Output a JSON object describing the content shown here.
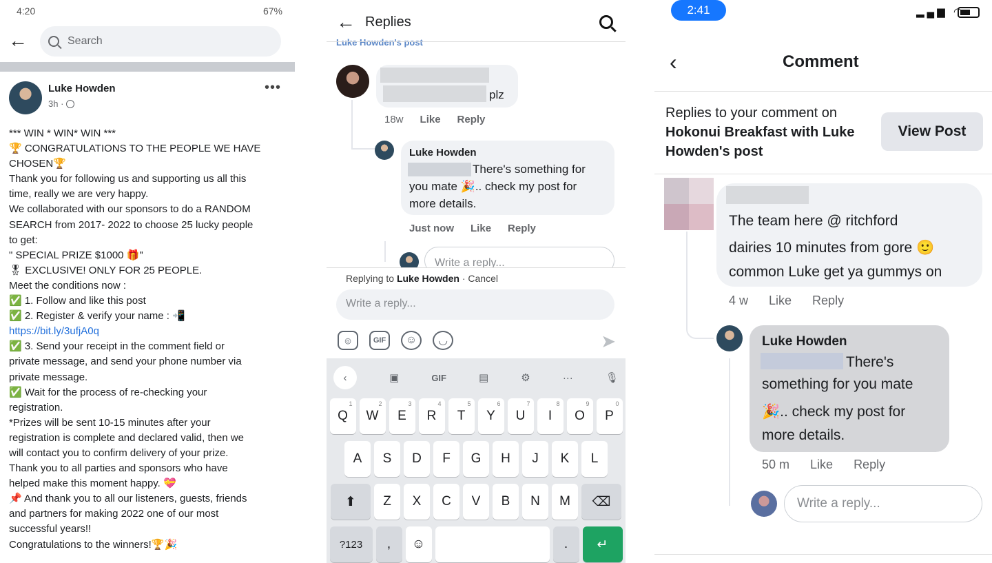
{
  "panel1": {
    "status_time": "4:20",
    "status_battery": "67%",
    "back_icon": "←",
    "search_placeholder": "Search",
    "author": "Luke Howden",
    "post_time": "3h ·",
    "more": "•••",
    "lines": [
      "*** WIN * WIN* WIN ***",
      "🏆 CONGRATULATIONS TO THE PEOPLE WE HAVE",
      "CHOSEN🏆",
      "Thank you for following us and supporting us all this",
      "time, really we are very happy.",
      "We collaborated with our sponsors to do a RANDOM",
      "SEARCH from 2017- 2022 to choose 25 lucky people",
      "to get:",
      "\" SPECIAL PRIZE $1000 🎁\"",
      "🎖 EXCLUSIVE! ONLY FOR 25 PEOPLE.",
      "Meet the conditions now :",
      "✅ 1. Follow and like this post",
      "✅ 2. Register & verify your name : 📲",
      "https://bit.ly/3ufjA0q",
      "✅ 3. Send your receipt in the comment field or",
      "private message, and send your phone number via",
      "private message.",
      "✅ Wait for the process of re-checking your",
      "registration.",
      "*Prizes will be sent 10-15 minutes after your",
      "registration is complete and declared valid, then we",
      "will contact you to confirm delivery of your prize.",
      "Thank you to all parties and sponsors who have",
      "helped make this moment happy. 💝",
      "📌 And thank you to all our listeners, guests, friends",
      "and partners for making 2022 one of our most",
      "successful years!!",
      "Congratulations to the winners!🏆🎉"
    ]
  },
  "panel2": {
    "title": "Replies",
    "cut_link": "Luke Howden's post",
    "c1_text": "plz",
    "c1_time": "18w",
    "like": "Like",
    "reply": "Reply",
    "c2_author": "Luke Howden",
    "c2_line1": "There's something for",
    "c2_line2": "you mate 🎉.. check my post for",
    "c2_line3": "more details.",
    "c2_time": "Just now",
    "write_reply_small": "Write a reply...",
    "replying_to_prefix": "Replying to",
    "replying_to_name": "Luke Howden",
    "cancel": "· Cancel",
    "input_placeholder": "Write a reply...",
    "gif": "GIF",
    "kb_gif": "GIF",
    "kb_more": "···",
    "row1": [
      [
        "Q",
        "1"
      ],
      [
        "W",
        "2"
      ],
      [
        "E",
        "3"
      ],
      [
        "R",
        "4"
      ],
      [
        "T",
        "5"
      ],
      [
        "Y",
        "6"
      ],
      [
        "U",
        "7"
      ],
      [
        "I",
        "8"
      ],
      [
        "O",
        "9"
      ],
      [
        "P",
        "0"
      ]
    ],
    "row2": [
      "A",
      "S",
      "D",
      "F",
      "G",
      "H",
      "J",
      "K",
      "L"
    ],
    "row3": [
      "Z",
      "X",
      "C",
      "V",
      "B",
      "N",
      "M"
    ],
    "sym": "?123",
    "comma": ",",
    "period": "."
  },
  "panel3": {
    "time": "2:41",
    "title": "Comment",
    "replies_line1": "Replies to your comment on",
    "replies_line2": "Hokonui Breakfast with Luke",
    "replies_line3": "Howden's post",
    "view_post": "View Post",
    "c1_line1": "The team here @ ritchford",
    "c1_line2": "dairies 10 minutes from gore 🙂",
    "c1_line3": "common Luke get ya gummys on",
    "c1_time": "4 w",
    "like": "Like",
    "reply": "Reply",
    "c2_author": "Luke Howden",
    "c2_line1": "There's",
    "c2_line2": "something for you mate",
    "c2_line3": "🎉.. check my post for",
    "c2_line4": "more details.",
    "c2_time": "50 m",
    "write_reply": "Write a reply..."
  }
}
